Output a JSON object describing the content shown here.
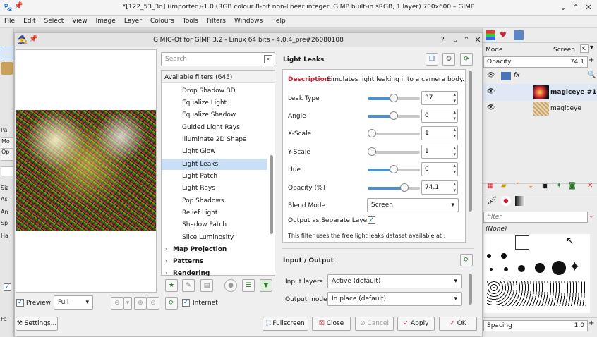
{
  "gimp": {
    "title": "*[122_53_3d] (imported)-1.0 (RGB colour 8-bit non-linear integer, GIMP built-in sRGB, 1 layer) 700x600 – GIMP",
    "menu": [
      "File",
      "Edit",
      "Select",
      "View",
      "Image",
      "Layer",
      "Colours",
      "Tools",
      "Filters",
      "Windows",
      "Help"
    ],
    "window_buttons": [
      "⌄",
      "⌃",
      "✕"
    ],
    "toolbox_fragments": [
      "Pai",
      "Mo",
      "Op",
      "Siz",
      "As",
      "An",
      "Sp",
      "Ha",
      "Fa"
    ]
  },
  "dock": {
    "mode_label": "Mode",
    "mode_value": "Screen",
    "opacity_label": "Opacity",
    "opacity_value": "74.1",
    "layers": [
      {
        "name": "magiceye #1",
        "bold": true
      },
      {
        "name": "magiceye",
        "bold": false
      }
    ],
    "brush_filter_placeholder": "filter",
    "brush_tag": "(None)",
    "spacing_label": "Spacing",
    "spacing_value": "1.0"
  },
  "gmic": {
    "title": "G'MIC-Qt for GIMP 3.2 - Linux 64 bits - 4.0.4_pre#26080108",
    "search_placeholder": "Search",
    "available_filters": "Available filters (645)",
    "filters": [
      "Drop Shadow 3D",
      "Equalize Light",
      "Equalize Shadow",
      "Guided Light Rays",
      "Illuminate 2D Shape",
      "Light Glow",
      "Light Leaks",
      "Light Patch",
      "Light Rays",
      "Pop Shadows",
      "Relief Light",
      "Shadow Patch",
      "Slice Luminosity"
    ],
    "selected_filter": "Light Leaks",
    "categories": [
      "Map Projection",
      "Patterns",
      "Rendering"
    ],
    "preview_label": "Preview",
    "preview_mode": "Full",
    "internet_label": "Internet",
    "settings_label": "Settings...",
    "filter_name": "Light Leaks",
    "description_label": "Description:",
    "description_text": "Simulates light leaking into a camera body.",
    "params": [
      {
        "label": "Leak Type",
        "value": "37",
        "fraction": 0.5
      },
      {
        "label": "Angle",
        "value": "0",
        "fraction": 0.5
      },
      {
        "label": "X-Scale",
        "value": "1",
        "fraction": 0.0
      },
      {
        "label": "Y-Scale",
        "value": "1",
        "fraction": 0.0
      },
      {
        "label": "Hue",
        "value": "0",
        "fraction": 0.5
      },
      {
        "label": "Opacity (%)",
        "value": "74.1",
        "fraction": 0.741
      }
    ],
    "blend_mode_label": "Blend Mode",
    "blend_mode_value": "Screen",
    "separate_layers_label": "Output as Separate Layers",
    "dataset_note": "This filter uses the free light leaks dataset available at :",
    "io_title": "Input / Output",
    "input_layers_label": "Input layers",
    "input_layers_value": "Active (default)",
    "output_mode_label": "Output mode",
    "output_mode_value": "In place (default)",
    "buttons": {
      "fullscreen": "Fullscreen",
      "close": "Close",
      "cancel": "Cancel",
      "apply": "Apply",
      "ok": "OK"
    }
  }
}
